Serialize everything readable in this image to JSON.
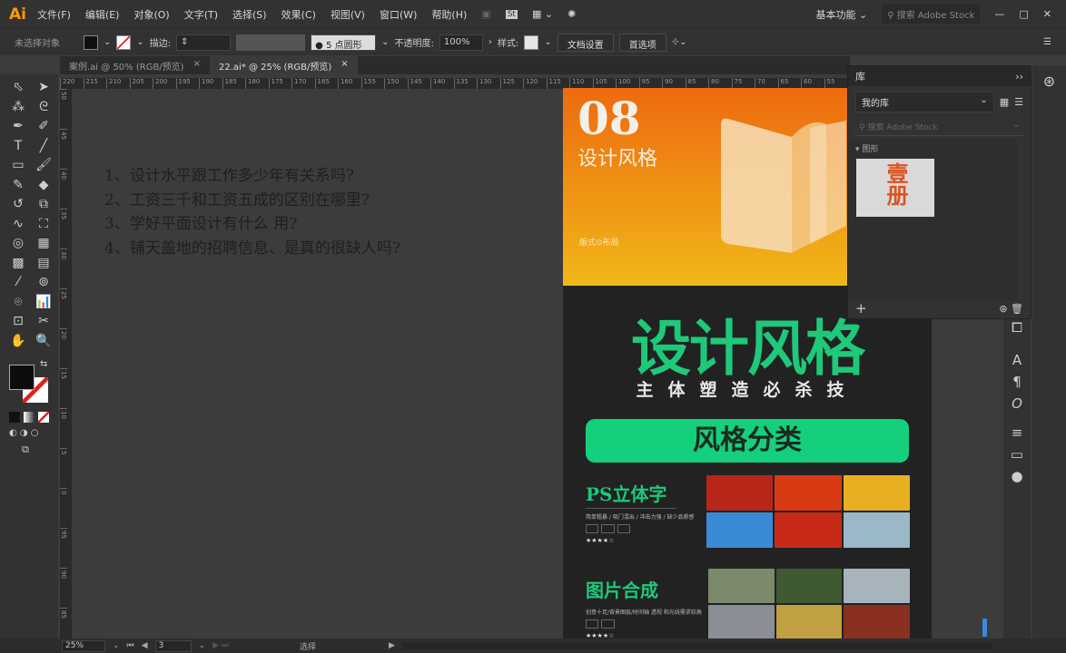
{
  "app": {
    "logo": "Ai",
    "menus": [
      "文件(F)",
      "编辑(E)",
      "对象(O)",
      "文字(T)",
      "选择(S)",
      "效果(C)",
      "视图(V)",
      "窗口(W)",
      "帮助(H)"
    ],
    "workspace": "基本功能",
    "stock_search": "搜索 Adobe Stock",
    "window_controls": [
      "—",
      "□",
      "✕"
    ]
  },
  "control": {
    "selection": "未选择对象",
    "stroke_label": "描边:",
    "brush": "5 点圆形",
    "opacity_label": "不透明度:",
    "opacity": "100%",
    "style_label": "样式:",
    "doc_setup": "文档设置",
    "prefs": "首选项"
  },
  "tabs": [
    {
      "label": "案例.ai @ 50% (RGB/预览)",
      "close": "×"
    },
    {
      "label": "22.ai* @ 25% (RGB/预览)",
      "close": "×",
      "active": true
    }
  ],
  "tools": [
    [
      "selection-tool",
      "⬁"
    ],
    [
      "direct-selection-tool",
      "➤"
    ],
    [
      "magic-wand-tool",
      "⁂"
    ],
    [
      "lasso-tool",
      "ᘓ"
    ],
    [
      "pen-tool",
      "✒"
    ],
    [
      "curvature-tool",
      "✐"
    ],
    [
      "type-tool",
      "T"
    ],
    [
      "line-tool",
      "╱"
    ],
    [
      "rectangle-tool",
      "▭"
    ],
    [
      "paintbrush-tool",
      "🖌"
    ],
    [
      "shaper-tool",
      "✎"
    ],
    [
      "eraser-tool",
      "◆"
    ],
    [
      "rotate-tool",
      "↺"
    ],
    [
      "scale-tool",
      "⧉"
    ],
    [
      "warp-tool",
      "∿"
    ],
    [
      "free-transform-tool",
      "⛶"
    ],
    [
      "shape-builder-tool",
      "◎"
    ],
    [
      "perspective-grid-tool",
      "▦"
    ],
    [
      "mesh-tool",
      "▩"
    ],
    [
      "gradient-tool",
      "▤"
    ],
    [
      "eyedropper-tool",
      "⁄"
    ],
    [
      "blend-tool",
      "⊚"
    ],
    [
      "symbol-sprayer-tool",
      "⌾"
    ],
    [
      "column-graph-tool",
      "📊"
    ],
    [
      "artboard-tool",
      "⊡"
    ],
    [
      "slice-tool",
      "✂"
    ],
    [
      "hand-tool",
      "✋"
    ],
    [
      "zoom-tool",
      "🔍"
    ]
  ],
  "rulers": {
    "top": [
      "220",
      "215",
      "210",
      "205",
      "200",
      "195",
      "190",
      "185",
      "180",
      "175",
      "170",
      "165",
      "160",
      "155",
      "150",
      "145",
      "140",
      "135",
      "130",
      "125",
      "120",
      "115",
      "110",
      "105",
      "100",
      "95",
      "90",
      "85",
      "80",
      "75",
      "70",
      "65",
      "60",
      "55"
    ],
    "left": [
      "50",
      "45",
      "40",
      "35",
      "30",
      "25",
      "20",
      "15",
      "10",
      "5",
      "0",
      "95",
      "90",
      "85"
    ]
  },
  "canvas": {
    "questions": [
      "1、设计水平跟工作多少年有关系吗?",
      "2、工资三千和工资五成的区别在哪里?",
      "3、学好平面设计有什么 用?",
      "4、铺天盖地的招聘信息、是真的很缺人吗?"
    ]
  },
  "artboard": {
    "number": "08",
    "hero_title": "设计风格",
    "hero_small": [
      "版式⊙布局"
    ],
    "big_title": "设计风格",
    "subtitle": "主体塑造必杀技",
    "pill": "风格分类",
    "sections": [
      {
        "title": "PS立体字",
        "desc": "简单粗暴 / 吸门混出 / 冲击力强 / 缺少品质感",
        "tags": [
          "",
          "",
          ""
        ],
        "stars": "★★★★☆"
      },
      {
        "title": "图片合成",
        "desc": "创意十足/背景图层/时间轴 透视 和光线需求较高",
        "tags": [
          "",
          ""
        ],
        "stars": "★★★★☆"
      }
    ],
    "colors": {
      "accent": "#1ec97a",
      "orange": "#ee6a10",
      "yellow": "#f0b818"
    }
  },
  "library": {
    "title": "库",
    "expand": "››",
    "library_name": "我的库",
    "search_placeholder": "搜索 Adobe Stock",
    "group": "▾ 图形",
    "thumb_text": "壹册",
    "add": "+"
  },
  "status": {
    "zoom": "25%",
    "page": "3",
    "mode": "选择"
  }
}
